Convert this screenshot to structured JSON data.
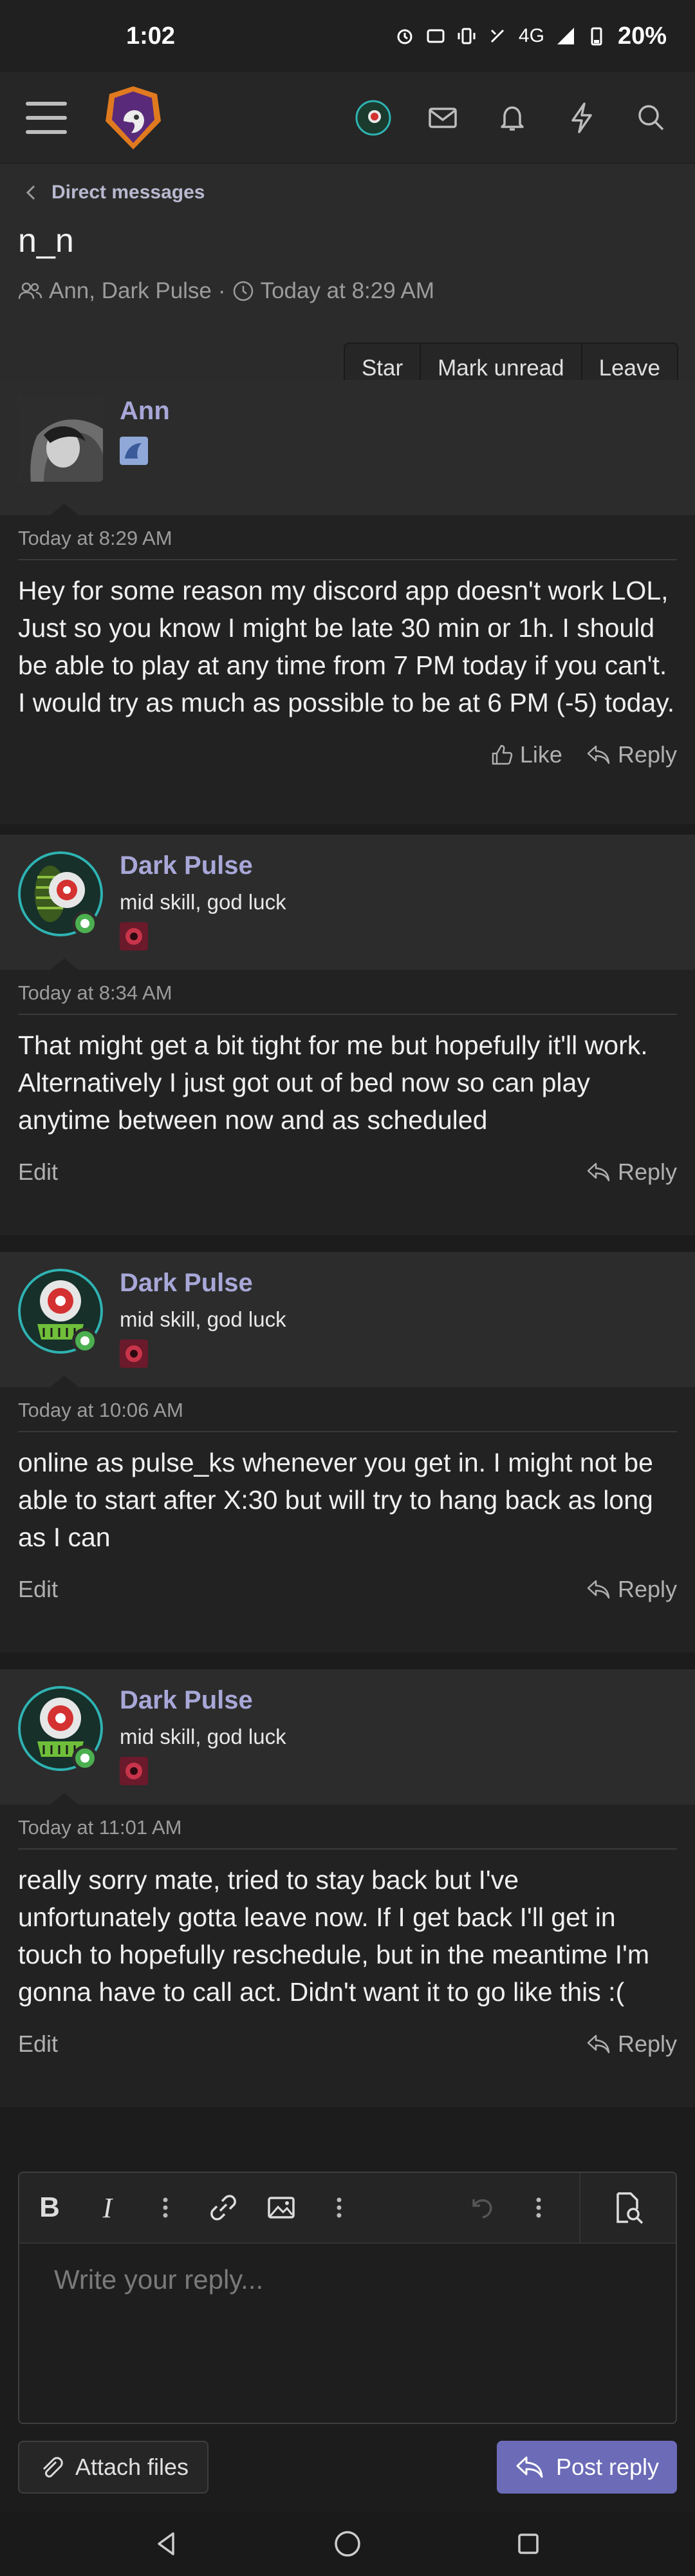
{
  "status_bar": {
    "time": "1:02",
    "network": "4G",
    "battery": "20%"
  },
  "header": {
    "icons": [
      "menu-icon",
      "site-logo",
      "user-avatar",
      "inbox-icon",
      "bell-icon",
      "bolt-icon",
      "search-icon"
    ]
  },
  "breadcrumb": {
    "label": "Direct messages"
  },
  "conversation": {
    "title": "n_n",
    "participants": "Ann, Dark Pulse",
    "separator": "·",
    "started": "Today at 8:29 AM",
    "actions": {
      "star": "Star",
      "mark_unread": "Mark unread",
      "leave": "Leave"
    }
  },
  "posts": [
    {
      "author": "Ann",
      "user_title": "",
      "date": "Today at 8:29 AM",
      "text": "Hey for some reason my discord app doesn't work LOL, Just so you know I might be late 30 min or 1h. I should be able to play at any time from 7 PM today if you can't. I would try as much as possible to be at 6 PM (-5) today.",
      "like": "Like",
      "reply": "Reply"
    },
    {
      "author": "Dark Pulse",
      "user_title": "mid skill, god luck",
      "date": "Today at 8:34 AM",
      "text": "That might get a bit tight for me but hopefully it'll work. Alternatively I just got out of bed now so can play anytime between now and as scheduled",
      "edit": "Edit",
      "reply": "Reply"
    },
    {
      "author": "Dark Pulse",
      "user_title": "mid skill, god luck",
      "date": "Today at 10:06 AM",
      "text": "online as pulse_ks whenever you get in. I might not be able to start after X:30 but will try to hang back as long as I can",
      "edit": "Edit",
      "reply": "Reply"
    },
    {
      "author": "Dark Pulse",
      "user_title": "mid skill, god luck",
      "date": "Today at 11:01 AM",
      "text": "really sorry mate, tried to stay back but I've unfortunately gotta leave now. If I get back I'll get in touch to hopefully reschedule, but in the meantime I'm gonna have to call act. Didn't want it to go like this :(",
      "edit": "Edit",
      "reply": "Reply"
    }
  ],
  "editor": {
    "toolbar": {
      "bold": "B",
      "italic": "I"
    },
    "placeholder": "Write your reply...",
    "attach_label": "Attach files",
    "post_label": "Post reply"
  },
  "colors": {
    "accent": "#6b6bb8",
    "username": "#a8a7d8",
    "online": "#4caf50"
  }
}
